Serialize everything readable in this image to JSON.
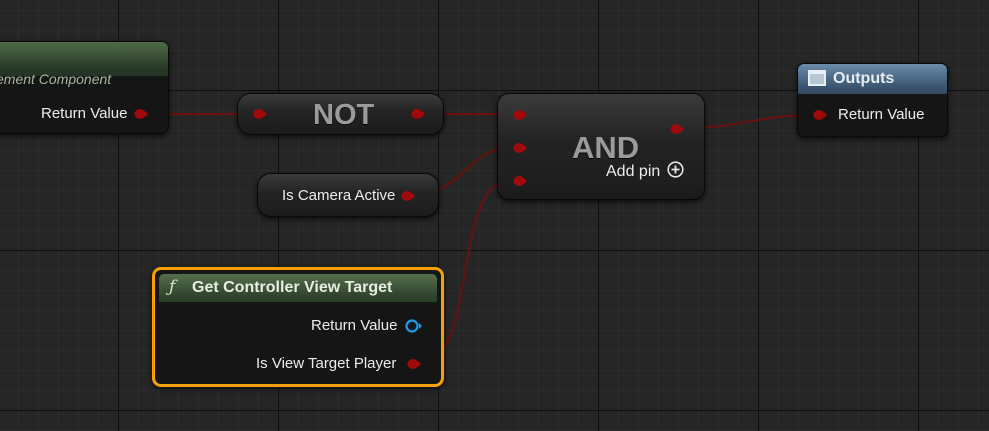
{
  "nodes": {
    "movement": {
      "title": "ement Component",
      "output": "Return Value"
    },
    "not": {
      "title": "NOT"
    },
    "camera": {
      "label": "Is Camera Active"
    },
    "and": {
      "title": "AND",
      "add_pin": "Add pin"
    },
    "outputs": {
      "title": "Outputs",
      "input": "Return Value"
    },
    "controller": {
      "title": "Get Controller View Target",
      "return_value": "Return Value",
      "is_view_target": "Is View Target Player",
      "icon": "function-icon"
    }
  },
  "colors": {
    "bool_pin": "#a00a0a",
    "object_pin": "#1e9be8",
    "wire": "#6b1010",
    "selection": "#f5a000",
    "green_header": "#4f6a45",
    "blue_header": "#46607a"
  }
}
